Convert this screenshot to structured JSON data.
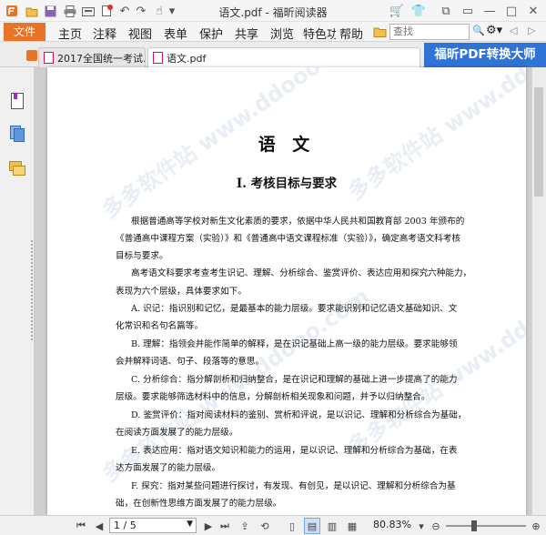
{
  "window": {
    "title": "语文.pdf - 福昕阅读器"
  },
  "menu": {
    "file": "文件",
    "tabs": [
      "主页",
      "注释",
      "视图",
      "表单",
      "保护",
      "共享",
      "浏览",
      "特色功",
      "帮助"
    ]
  },
  "search": {
    "placeholder": "查找"
  },
  "doc_tabs": [
    {
      "label": "2017全国统一考试..."
    },
    {
      "label": "语文.pdf"
    }
  ],
  "promo": {
    "text": "福昕PDF转换大师"
  },
  "page": {
    "title": "语 文",
    "heading": "Ⅰ. 考核目标与要求",
    "lines": [
      "根据普通高等学校对新生文化素质的要求，依据中华人民共和国教育部 2003 年颁布的",
      "《普通高中课程方案（实验）》和《普通高中语文课程标准（实验）》，确定高考语文科考核",
      "目标与要求。",
      "高考语文科要求考查考生识记、理解、分析综合、鉴赏评价、表达应用和探究六种能力，",
      "表现为六个层级，具体要求如下。",
      "A. 识记：指识别和记忆，是最基本的能力层级。要求能识别和记忆语文基础知识、文",
      "化常识和名句名篇等。",
      "B. 理解：指领会并能作简单的解释，是在识记基础上高一级的能力层级。要求能够领",
      "会并解释词语、句子、段落等的意思。",
      "C. 分析综合：指分解剖析和归纳整合，是在识记和理解的基础上进一步提高了的能力",
      "层级。要求能够筛选材料中的信息，分解剖析相关现象和问题，并予以归纳整合。",
      "D. 鉴赏评价：指对阅读材料的鉴别、赏析和评说，是以识记、理解和分析综合为基础，",
      "在阅读方面发展了的能力层级。",
      "E. 表达应用：指对语文知识和能力的运用，是以识记、理解和分析综合为基础，在表",
      "达方面发展了的能力层级。",
      "F. 探究：指对某些问题进行探讨，有发现、有创见，是以识记、理解和分析综合为基",
      "础，在创新性思维方面发展了的能力层级。"
    ],
    "watermark": "多多软件站 www.ddooo.com"
  },
  "status": {
    "page": "1 / 5",
    "zoom": "80.83%"
  },
  "colors": {
    "file_tab": "#e8742a",
    "promo": "#2f73d6"
  }
}
